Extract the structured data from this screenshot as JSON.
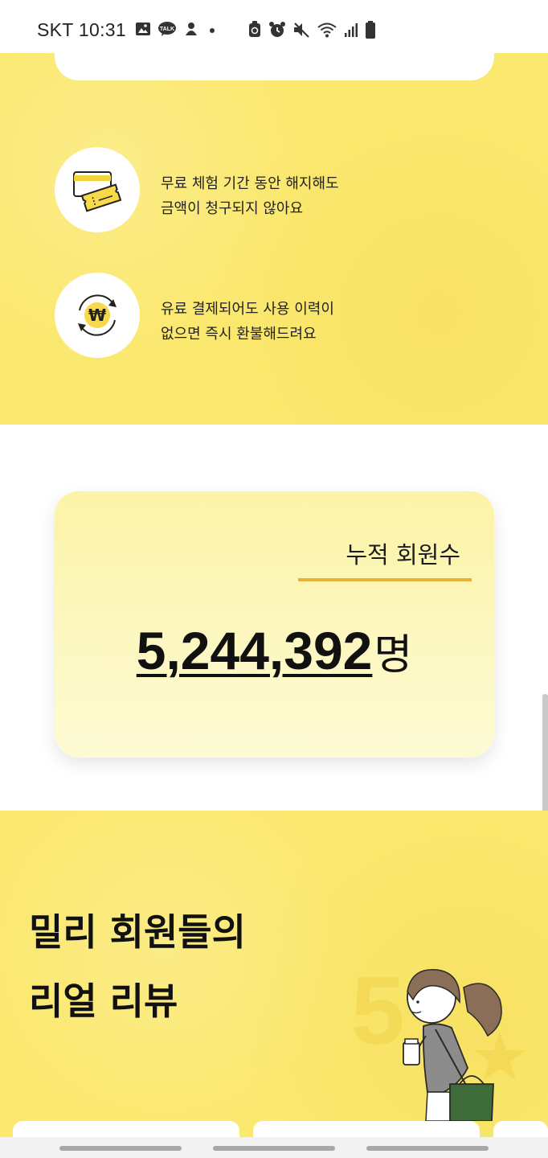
{
  "status_bar": {
    "carrier_time": "SKT 10:31",
    "left_icons": [
      "image-icon",
      "kakaotalk-icon",
      "notification-icon",
      "dot-icon"
    ],
    "right_icons": [
      "recycle-icon",
      "alarm-icon",
      "mute-icon",
      "wifi-icon",
      "signal-icon",
      "battery-icon"
    ]
  },
  "benefits": [
    {
      "icon": "ticket-card-icon",
      "line1": "무료 체험 기간 동안 해지해도",
      "line2": "금액이 청구되지 않아요"
    },
    {
      "icon": "refund-won-icon",
      "line1": "유료 결제되어도 사용 이력이",
      "line2": "없으면 즉시 환불해드려요"
    }
  ],
  "member_count": {
    "label": "누적 회원수",
    "value": "5,244,392",
    "unit": "명"
  },
  "reviews": {
    "title_line1": "밀리 회원들의",
    "title_line2": "리얼 리뷰"
  },
  "colors": {
    "yellow_bg": "#fbe86e",
    "card_bg": "#fcf3a6",
    "accent_line": "#e8b23a"
  }
}
